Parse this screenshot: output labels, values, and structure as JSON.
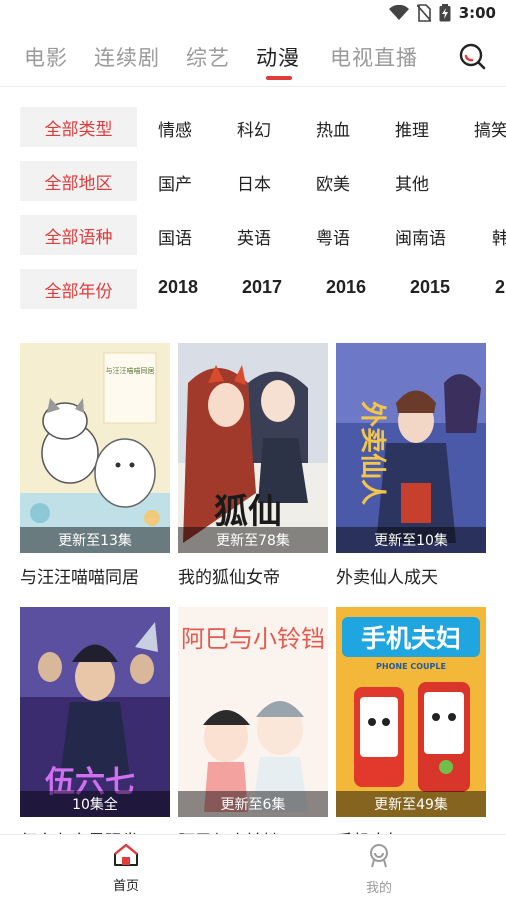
{
  "status": {
    "time": "3:00"
  },
  "tabs": [
    {
      "label": "电影"
    },
    {
      "label": "连续剧"
    },
    {
      "label": "综艺"
    },
    {
      "label": "动漫"
    },
    {
      "label": "电视直播"
    }
  ],
  "active_tab": "动漫",
  "filters": {
    "type": {
      "label": "全部类型",
      "options": [
        "情感",
        "科幻",
        "热血",
        "推理",
        "搞笑"
      ]
    },
    "region": {
      "label": "全部地区",
      "options": [
        "国产",
        "日本",
        "欧美",
        "其他"
      ]
    },
    "language": {
      "label": "全部语种",
      "options": [
        "国语",
        "英语",
        "粤语",
        "闽南语",
        "韩"
      ]
    },
    "year": {
      "label": "全部年份",
      "options": [
        "2018",
        "2017",
        "2016",
        "2015",
        "2"
      ]
    }
  },
  "cards": [
    {
      "title": "与汪汪喵喵同居",
      "badge": "更新至13集",
      "poster_text": "与汪汪喵喵同居"
    },
    {
      "title": "我的狐仙女帝",
      "badge": "更新至78集",
      "poster_text": "狐仙"
    },
    {
      "title": "外卖仙人成天",
      "badge": "更新至10集",
      "poster_text": "外卖仙人"
    },
    {
      "title": "伍六七之最强发",
      "badge": "10集全",
      "poster_text": "伍六七"
    },
    {
      "title": "阿巳与小铃铛",
      "badge": "更新至6集",
      "poster_text": "阿巳与小铃铛"
    },
    {
      "title": "手机夫妇",
      "badge": "更新至49集",
      "poster_text": "手机夫妇",
      "poster_subtext": "PHONE COUPLE"
    }
  ],
  "bottom_nav": [
    {
      "label": "首页",
      "icon": "home-icon",
      "active": true
    },
    {
      "label": "我的",
      "icon": "profile-icon",
      "active": false
    }
  ],
  "colors": {
    "accent": "#e23b3b",
    "inactive": "#9a9a9a",
    "label_bg": "#f2f2f2"
  }
}
